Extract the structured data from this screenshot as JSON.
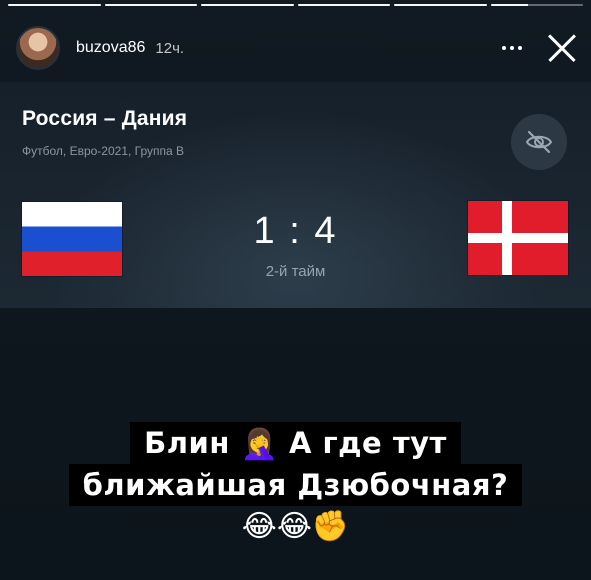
{
  "story": {
    "progress_segments": [
      1,
      1,
      1,
      1,
      1,
      0.4
    ],
    "username": "buzova86",
    "time_ago": "12ч."
  },
  "match": {
    "title": "Россия – Дания",
    "subtitle": "Футбол, Евро-2021, Группа B",
    "score": "1 : 4",
    "period": "2-й тайм",
    "home_flag": "russia-flag",
    "away_flag": "denmark-flag"
  },
  "caption": {
    "line1": "Блин",
    "line1_emoji": "🤦‍♀️",
    "line1_rest": "А где тут",
    "line2": "ближайшая Дзюбочная?",
    "emojis": "😂😂✊"
  },
  "colors": {
    "background": "#10171e",
    "card": "#1a2530",
    "ru_white": "#ffffff",
    "ru_blue": "#1a4fd0",
    "ru_red": "#e0202a",
    "dk_red": "#e11d2b"
  }
}
